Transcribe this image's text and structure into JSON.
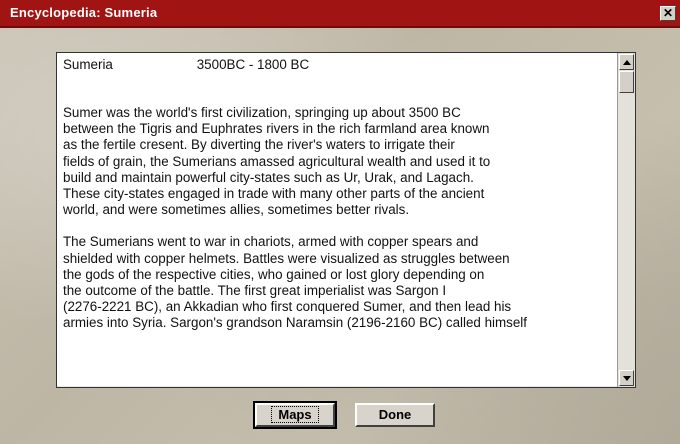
{
  "window": {
    "title": "Encyclopedia:  Sumeria",
    "close_glyph": "✕"
  },
  "article": {
    "name": "Sumeria",
    "dates": "3500BC - 1800 BC",
    "paragraphs": [
      "Sumer was the world's first civilization, springing up about 3500 BC\nbetween the Tigris and Euphrates rivers in the rich farmland area known\nas the fertile cresent.  By diverting the river's waters to irrigate their\nfields of grain, the Sumerians amassed agricultural wealth and used it to\nbuild and maintain powerful city-states such as Ur, Urak, and Lagach.\nThese city-states engaged in trade with many other parts of the ancient\nworld, and were sometimes allies, sometimes better rivals.",
      "The Sumerians went to war in chariots, armed with copper spears and\nshielded with copper helmets.  Battles were visualized as struggles between\nthe gods of the respective cities, who gained or lost glory depending on\nthe outcome of the battle.  The first great imperialist was Sargon I\n(2276-2221 BC), an Akkadian who first conquered Sumer, and then lead his\narmies into Syria.  Sargon's grandson Naramsin (2196-2160 BC) called himself"
    ]
  },
  "buttons": {
    "maps": "Maps",
    "done": "Done"
  },
  "colors": {
    "titlebar": "#a01414",
    "panel": "#ffffff",
    "background": "#c2bcab"
  },
  "icons": {
    "scroll_up": "arrow-up-icon",
    "scroll_down": "arrow-down-icon",
    "close": "close-icon"
  }
}
